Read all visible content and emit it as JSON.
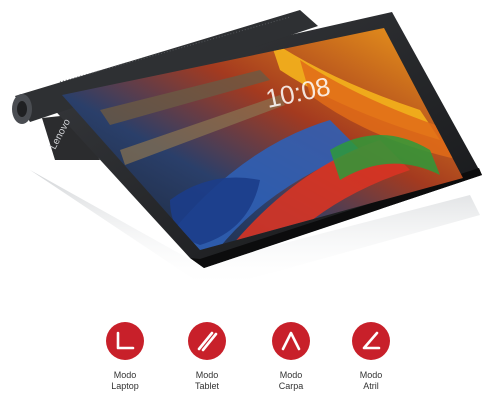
{
  "brand": {
    "logo_text": "Lenovo"
  },
  "device": {
    "lockscreen_time": "10:08"
  },
  "accent_color": "#c8202a",
  "modes": [
    {
      "line1": "Modo",
      "line2": "Laptop",
      "icon": "laptop-mode-icon"
    },
    {
      "line1": "Modo",
      "line2": "Tablet",
      "icon": "tablet-mode-icon"
    },
    {
      "line1": "Modo",
      "line2": "Carpa",
      "icon": "tent-mode-icon"
    },
    {
      "line1": "Modo",
      "line2": "Atril",
      "icon": "stand-mode-icon"
    }
  ]
}
